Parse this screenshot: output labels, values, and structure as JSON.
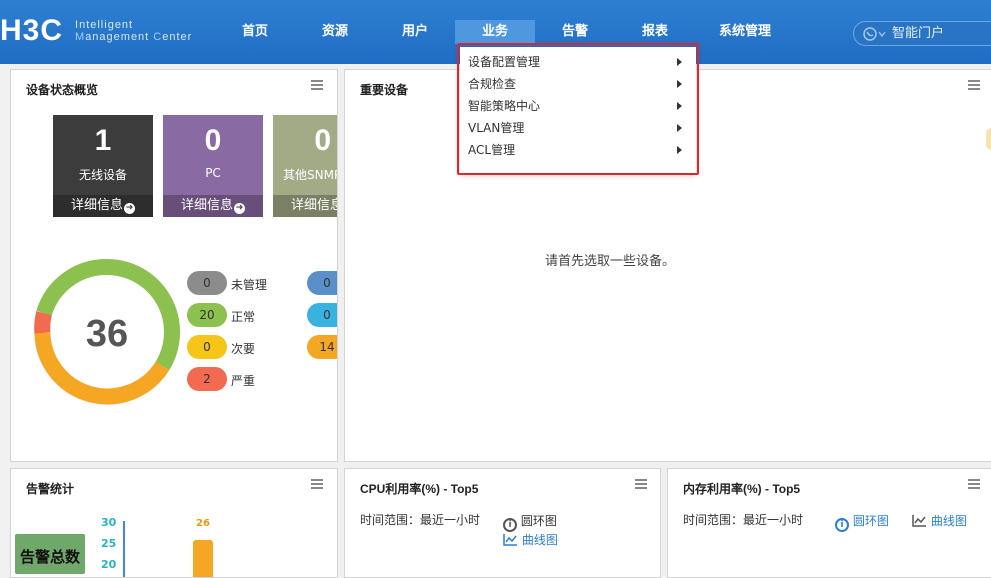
{
  "brand": {
    "logo": "H3C",
    "line1": "Intelligent",
    "line2_a": "M",
    "line2_b": "anagement ",
    "line2_c": "C",
    "line2_d": "enter"
  },
  "nav": [
    {
      "label": "首页"
    },
    {
      "label": "资源"
    },
    {
      "label": "用户"
    },
    {
      "label": "业务"
    },
    {
      "label": "告警"
    },
    {
      "label": "报表"
    },
    {
      "label": "系统管理"
    }
  ],
  "search": {
    "placeholder": "智能门户"
  },
  "dropdown": [
    {
      "label": "设备配置管理"
    },
    {
      "label": "合规检查"
    },
    {
      "label": "智能策略中心"
    },
    {
      "label": "VLAN管理"
    },
    {
      "label": "ACL管理"
    }
  ],
  "device_overview": {
    "title": "设备状态概览",
    "tiles": [
      {
        "num": "1",
        "label": "无线设备",
        "foot": "详细信息",
        "color": "#3c3c3c"
      },
      {
        "num": "0",
        "label": "PC",
        "foot": "详细信息",
        "color": "#8a6aa3"
      },
      {
        "num": "0",
        "label": "其他SNMP",
        "foot": "详细信息",
        "color": "#a3ab86"
      }
    ],
    "total": "36",
    "legend_left": [
      {
        "count": "0",
        "label": "未管理",
        "color": "#8c8c8c"
      },
      {
        "count": "20",
        "label": "正常",
        "color": "#8cc04f"
      },
      {
        "count": "0",
        "label": "次要",
        "color": "#f5c518"
      },
      {
        "count": "2",
        "label": "严重",
        "color": "#f26a4f"
      }
    ],
    "legend_right": [
      {
        "count": "0",
        "color": "#5b8fc9"
      },
      {
        "count": "0",
        "color": "#38b3e0"
      },
      {
        "count": "14",
        "color": "#f5a623"
      }
    ]
  },
  "important_devices": {
    "title": "重要设备",
    "empty_msg": "请首先选取一些设备。"
  },
  "alarm_stats": {
    "title": "告警统计",
    "total_label": "告警总数",
    "y_ticks": [
      "30",
      "25",
      "20"
    ],
    "bar_value": "26"
  },
  "cpu": {
    "title": "CPU利用率(%) - Top5",
    "range": "时间范围：最近一小时",
    "ring": "圆环图",
    "line": "曲线图"
  },
  "mem": {
    "title": "内存利用率(%) - Top5",
    "range": "时间范围：最近一小时",
    "ring": "圆环图",
    "line": "曲线图"
  }
}
